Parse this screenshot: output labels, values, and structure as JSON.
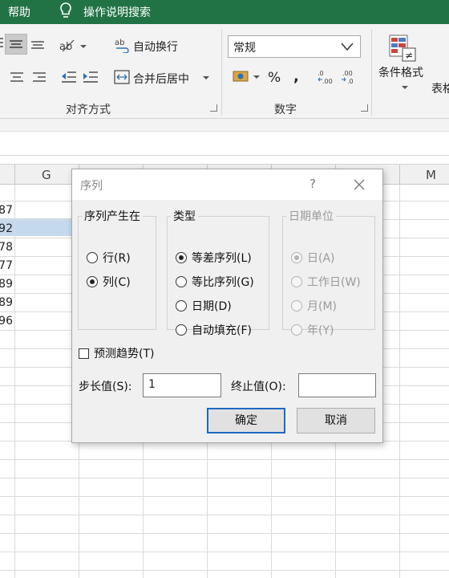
{
  "menubar": {
    "help": "帮助",
    "tell_me": "操作说明搜索"
  },
  "ribbon": {
    "wrap_text": "自动换行",
    "merge_center": "合并后居中",
    "alignment_group": "对齐方式",
    "number_format": "常规",
    "percent": "%",
    "comma": ",",
    "number_group": "数字",
    "conditional_format": "条件格式",
    "table_format_partial": "表格",
    "icons": [
      "align-center-icon",
      "align-right-icon",
      "orientation-icon",
      "decrease-indent-icon",
      "increase-indent-icon",
      "wrap-text-icon",
      "merge-center-icon",
      "accounting-icon",
      "increase-decimal-icon",
      "decrease-decimal-icon",
      "conditional-format-icon"
    ]
  },
  "sheet": {
    "columns": [
      "G",
      "M"
    ],
    "partial_values": [
      "87",
      "92",
      "78",
      "77",
      "89",
      "89",
      "96"
    ],
    "selected_color": "#c5d9ee"
  },
  "dialog": {
    "title": "序列",
    "help": "?",
    "series_in": {
      "label": "序列产生在",
      "options": [
        {
          "label": "行(R)",
          "checked": false
        },
        {
          "label": "列(C)",
          "checked": true
        }
      ]
    },
    "type": {
      "label": "类型",
      "options": [
        {
          "label": "等差序列(L)",
          "checked": true
        },
        {
          "label": "等比序列(G)",
          "checked": false
        },
        {
          "label": "日期(D)",
          "checked": false
        },
        {
          "label": "自动填充(F)",
          "checked": false
        }
      ]
    },
    "date_unit": {
      "label": "日期单位",
      "options": [
        {
          "label": "日(A)",
          "checked": true
        },
        {
          "label": "工作日(W)",
          "checked": false
        },
        {
          "label": "月(M)",
          "checked": false
        },
        {
          "label": "年(Y)",
          "checked": false
        }
      ]
    },
    "trend": "预测趋势(T)",
    "step_label": "步长值(S):",
    "step_value": "1",
    "stop_label": "终止值(O):",
    "stop_value": "",
    "ok": "确定",
    "cancel": "取消"
  },
  "colors": {
    "excel_green": "#217346",
    "default_button_border": "#1e69c5"
  }
}
